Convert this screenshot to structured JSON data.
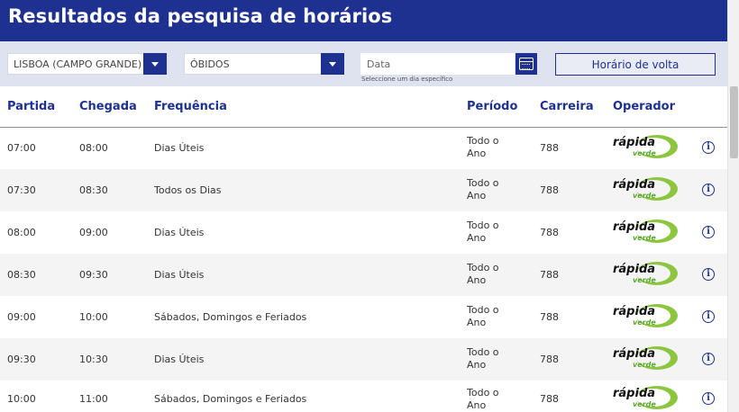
{
  "page_title": "Resultados da pesquisa de horários",
  "filters": {
    "origin": "LISBOA (CAMPO GRANDE)",
    "destination": "ÓBIDOS",
    "date_placeholder": "Data",
    "date_hint": "Seleccione um dia específico",
    "return_button": "Horário de volta"
  },
  "columns": {
    "departure": "Partida",
    "arrival": "Chegada",
    "frequency": "Frequência",
    "period": "Período",
    "route": "Carreira",
    "operator": "Operador"
  },
  "operator_logo": {
    "word1": "rápida",
    "word2": "verde",
    "brand_color": "#8cc63f"
  },
  "info_glyph": "i",
  "rows": [
    {
      "departure": "07:00",
      "arrival": "08:00",
      "frequency": "Dias Úteis",
      "period": "Todo o Ano",
      "route": "788"
    },
    {
      "departure": "07:30",
      "arrival": "08:30",
      "frequency": "Todos os Dias",
      "period": "Todo o Ano",
      "route": "788"
    },
    {
      "departure": "08:00",
      "arrival": "09:00",
      "frequency": "Dias Úteis",
      "period": "Todo o Ano",
      "route": "788"
    },
    {
      "departure": "08:30",
      "arrival": "09:30",
      "frequency": "Dias Úteis",
      "period": "Todo o Ano",
      "route": "788"
    },
    {
      "departure": "09:00",
      "arrival": "10:00",
      "frequency": "Sábados, Domingos e Feriados",
      "period": "Todo o Ano",
      "route": "788"
    },
    {
      "departure": "09:30",
      "arrival": "10:30",
      "frequency": "Dias Úteis",
      "period": "Todo o Ano",
      "route": "788"
    },
    {
      "departure": "10:00",
      "arrival": "11:00",
      "frequency": "Sábados, Domingos e Feriados",
      "period": "Todo o Ano",
      "route": "788"
    }
  ],
  "colors": {
    "primary": "#1e3191",
    "filter_bg": "#dfe3ef",
    "row_alt": "#f4f4f4"
  }
}
